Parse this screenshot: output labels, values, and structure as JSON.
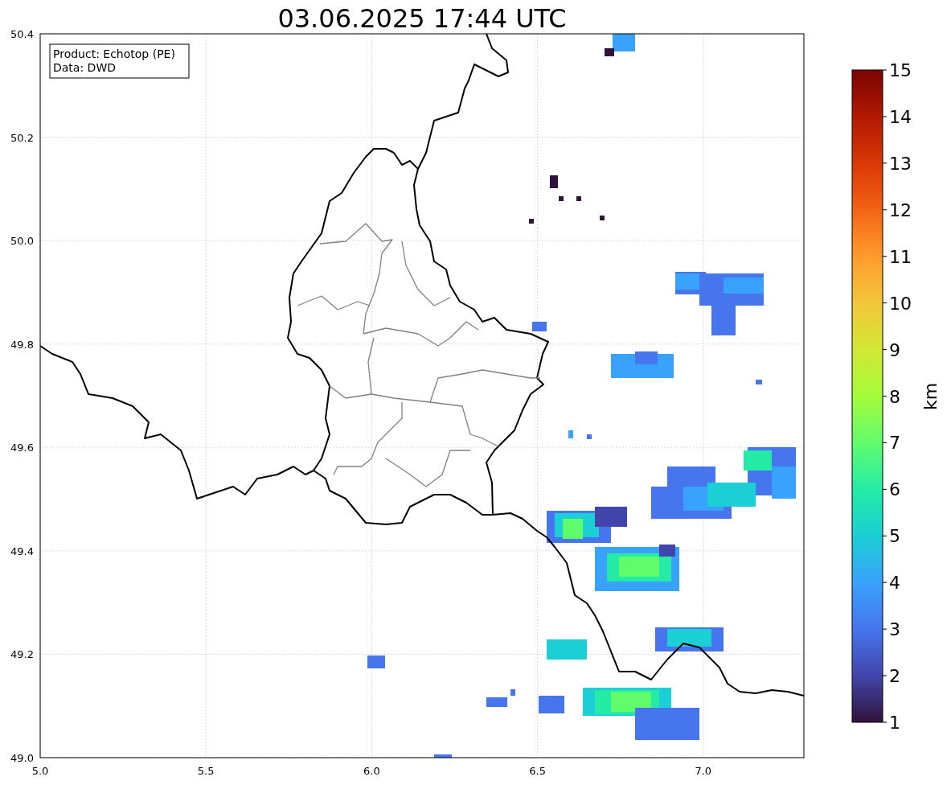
{
  "title": "03.06.2025 17:44 UTC",
  "info_box": [
    "Product: Echotop (PE)",
    "Data: DWD"
  ],
  "x_axis": {
    "ticks": [
      "5.0",
      "5.5",
      "6.0",
      "6.5",
      "7.0"
    ]
  },
  "y_axis": {
    "ticks": [
      "50.4",
      "50.2",
      "50.0",
      "49.8",
      "49.6",
      "49.4",
      "49.2",
      "49.0"
    ]
  },
  "colorbar": {
    "label": "km",
    "ticks": [
      "15",
      "14",
      "13",
      "12",
      "11",
      "10",
      "9",
      "8",
      "7",
      "6",
      "5",
      "4",
      "3",
      "2",
      "1"
    ]
  }
}
